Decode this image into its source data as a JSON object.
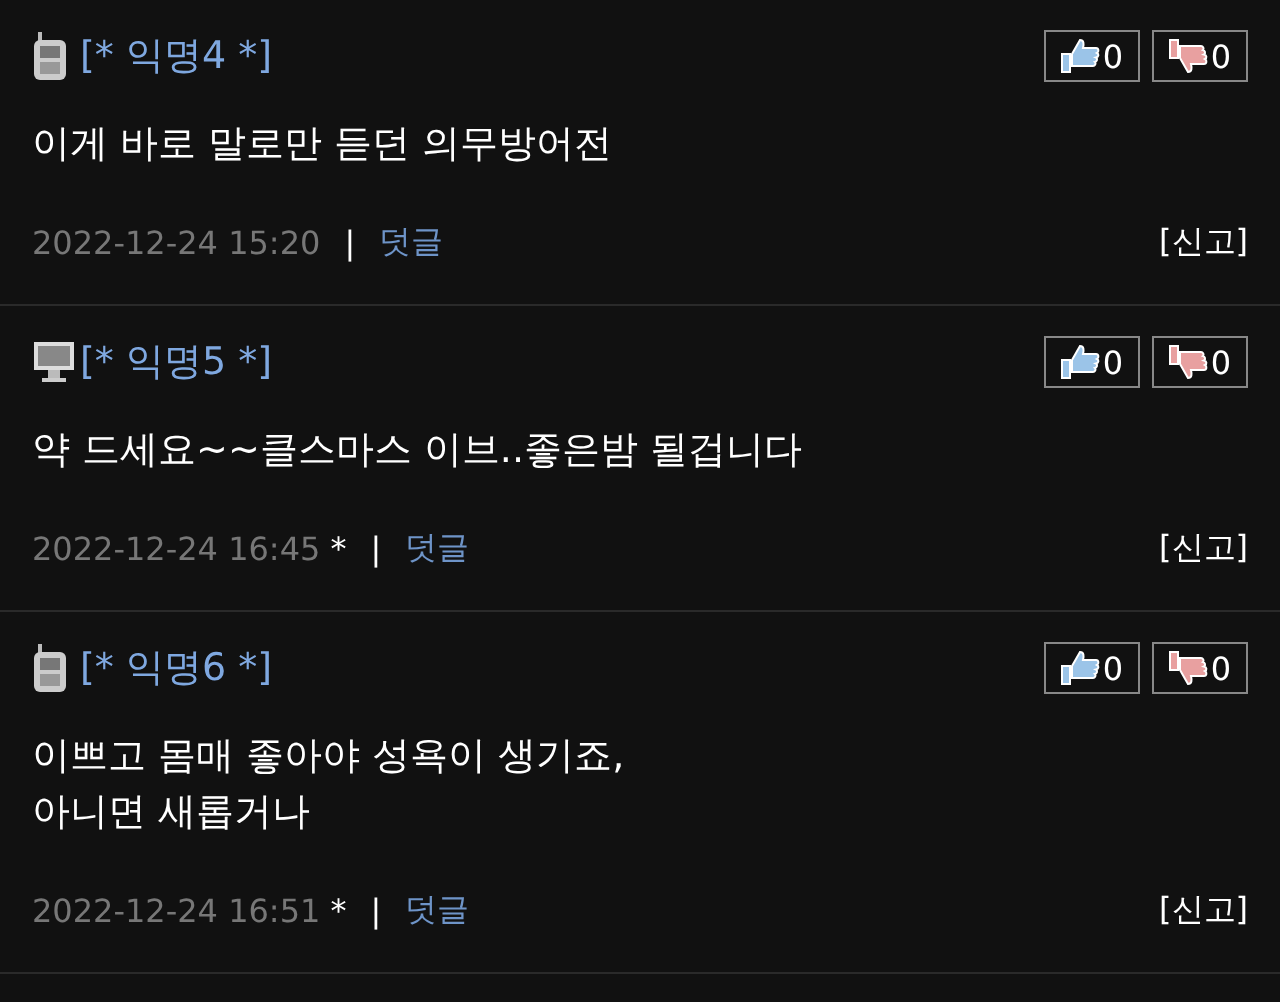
{
  "comments": [
    {
      "kind": "phone",
      "author": "[* 익명4 *]",
      "up": "0",
      "down": "0",
      "lines": [
        "이게 바로 말로만 듣던 의무방어전"
      ],
      "date": "2022-12-24 15:20",
      "separator": "|",
      "reply": "덧글",
      "report": "[신고]"
    },
    {
      "kind": "pc",
      "author": "[* 익명5 *]",
      "up": "0",
      "down": "0",
      "lines": [
        "약 드세요~~클스마스 이브..좋은밤 될겁니다"
      ],
      "date": "2022-12-24 16:45",
      "edited_mark": "*",
      "separator": "|",
      "reply": "덧글",
      "report": "[신고]"
    },
    {
      "kind": "phone",
      "author": "[* 익명6 *]",
      "up": "0",
      "down": "0",
      "lines": [
        "이쁘고 몸매 좋아야 성욕이 생기죠,",
        "아니면 새롭거나"
      ],
      "date": "2022-12-24 16:51",
      "edited_mark": "*",
      "separator": "|",
      "reply": "덧글",
      "report": "[신고]"
    }
  ]
}
